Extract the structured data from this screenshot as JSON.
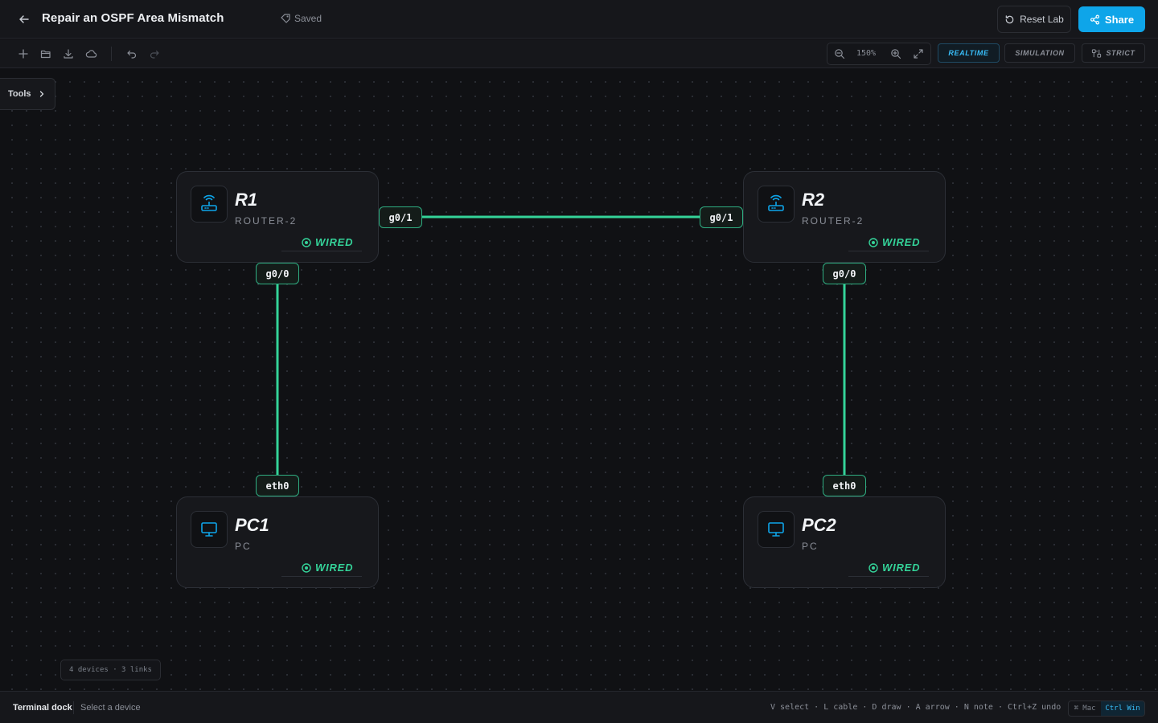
{
  "header": {
    "title": "Repair an OSPF Area Mismatch",
    "saved_label": "Saved",
    "reset_label": "Reset Lab",
    "share_label": "Share"
  },
  "toolbar": {
    "zoom_level": "150%",
    "modes": [
      {
        "label": "REALTIME",
        "active": true
      },
      {
        "label": "SIMULATION",
        "active": false
      },
      {
        "label": "STRICT",
        "active": false
      }
    ]
  },
  "tools_tab": {
    "label": "Tools"
  },
  "nodes": [
    {
      "name": "R1",
      "type": "ROUTER-2",
      "status": "WIRED",
      "icon": "router-icon"
    },
    {
      "name": "R2",
      "type": "ROUTER-2",
      "status": "WIRED",
      "icon": "router-icon"
    },
    {
      "name": "PC1",
      "type": "PC",
      "status": "WIRED",
      "icon": "monitor-icon"
    },
    {
      "name": "PC2",
      "type": "PC",
      "status": "WIRED",
      "icon": "monitor-icon"
    }
  ],
  "links": [
    {
      "from": "R1",
      "from_port": "g0/1",
      "to": "R2",
      "to_port": "g0/1"
    },
    {
      "from": "R1",
      "from_port": "g0/0",
      "to": "PC1",
      "to_port": "eth0"
    },
    {
      "from": "R2",
      "from_port": "g0/0",
      "to": "PC2",
      "to_port": "eth0"
    }
  ],
  "counts": "4 devices · 3 links",
  "dock": {
    "title": "Terminal dock",
    "status": "Select a device",
    "shortcuts": "V select · L cable · D draw · A arrow · N note · Ctrl+Z undo",
    "os_mac": "⌘ Mac",
    "os_win": "Ctrl Win"
  },
  "colors": {
    "accent": "#0ea5e9",
    "link": "#34d399",
    "background": "#101114"
  }
}
